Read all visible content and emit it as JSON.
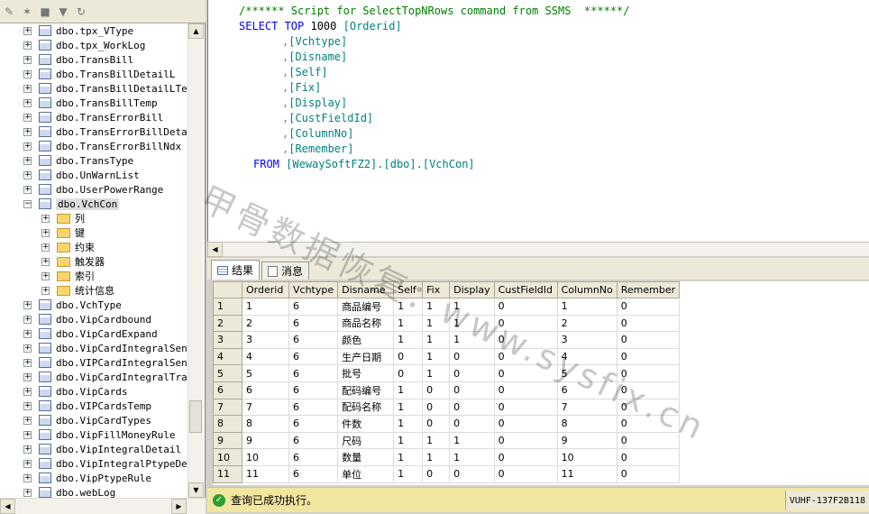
{
  "tree": {
    "items": [
      {
        "label": "dbo.tpx_VType",
        "type": "table",
        "level": 0
      },
      {
        "label": "dbo.tpx_WorkLog",
        "type": "table",
        "level": 0
      },
      {
        "label": "dbo.TransBill",
        "type": "table",
        "level": 0
      },
      {
        "label": "dbo.TransBillDetailL",
        "type": "table",
        "level": 0
      },
      {
        "label": "dbo.TransBillDetailLTemp",
        "type": "table",
        "level": 0
      },
      {
        "label": "dbo.TransBillTemp",
        "type": "table",
        "level": 0
      },
      {
        "label": "dbo.TransErrorBill",
        "type": "table",
        "level": 0
      },
      {
        "label": "dbo.TransErrorBillDetailL",
        "type": "table",
        "level": 0
      },
      {
        "label": "dbo.TransErrorBillNdx",
        "type": "table",
        "level": 0
      },
      {
        "label": "dbo.TransType",
        "type": "table",
        "level": 0
      },
      {
        "label": "dbo.UnWarnList",
        "type": "table",
        "level": 0
      },
      {
        "label": "dbo.UserPowerRange",
        "type": "table",
        "level": 0
      },
      {
        "label": "dbo.VchCon",
        "type": "table",
        "level": 0,
        "expanded": true,
        "selected": true
      },
      {
        "label": "列",
        "type": "folder",
        "level": 1
      },
      {
        "label": "键",
        "type": "folder",
        "level": 1
      },
      {
        "label": "约束",
        "type": "folder",
        "level": 1
      },
      {
        "label": "触发器",
        "type": "folder",
        "level": 1
      },
      {
        "label": "索引",
        "type": "folder",
        "level": 1
      },
      {
        "label": "统计信息",
        "type": "folder",
        "level": 1
      },
      {
        "label": "dbo.VchType",
        "type": "table",
        "level": 0
      },
      {
        "label": "dbo.VipCardbound",
        "type": "table",
        "level": 0
      },
      {
        "label": "dbo.VipCardExpand",
        "type": "table",
        "level": 0
      },
      {
        "label": "dbo.VipCardIntegralSend",
        "type": "table",
        "level": 0
      },
      {
        "label": "dbo.VIPCardIntegralSendTe",
        "type": "table",
        "level": 0
      },
      {
        "label": "dbo.VipCardIntegralTrans",
        "type": "table",
        "level": 0
      },
      {
        "label": "dbo.VipCards",
        "type": "table",
        "level": 0
      },
      {
        "label": "dbo.VIPCardsTemp",
        "type": "table",
        "level": 0
      },
      {
        "label": "dbo.VipCardTypes",
        "type": "table",
        "level": 0
      },
      {
        "label": "dbo.VipFillMoneyRule",
        "type": "table",
        "level": 0
      },
      {
        "label": "dbo.VipIntegralDetail",
        "type": "table",
        "level": 0
      },
      {
        "label": "dbo.VipIntegralPtypeDeta",
        "type": "table",
        "level": 0
      },
      {
        "label": "dbo.VipPtypeRule",
        "type": "table",
        "level": 0
      },
      {
        "label": "dbo.webLog",
        "type": "table",
        "level": 0
      }
    ]
  },
  "sql": {
    "comment": "/****** Script for SelectTopNRows command from SSMS  ******/",
    "select": "SELECT TOP",
    "top_n": "1000",
    "first_col": "[Orderid]",
    "columns": [
      "[Vchtype]",
      "[Disname]",
      "[Self]",
      "[Fix]",
      "[Display]",
      "[CustFieldId]",
      "[ColumnNo]",
      "[Remember]"
    ],
    "from_kw": "FROM",
    "from_obj": "[WewaySoftFZ2].[dbo].[VchCon]"
  },
  "tabs": {
    "results": "结果",
    "messages": "消息"
  },
  "grid": {
    "headers": [
      "",
      "Orderid",
      "Vchtype",
      "Disname",
      "Self",
      "Fix",
      "Display",
      "CustFieldId",
      "ColumnNo",
      "Remember"
    ],
    "rows": [
      [
        "1",
        "1",
        "6",
        "商品编号",
        "1",
        "1",
        "1",
        "0",
        "1",
        "0"
      ],
      [
        "2",
        "2",
        "6",
        "商品名称",
        "1",
        "1",
        "1",
        "0",
        "2",
        "0"
      ],
      [
        "3",
        "3",
        "6",
        "颜色",
        "1",
        "1",
        "1",
        "0",
        "3",
        "0"
      ],
      [
        "4",
        "4",
        "6",
        "生产日期",
        "0",
        "1",
        "0",
        "0",
        "4",
        "0"
      ],
      [
        "5",
        "5",
        "6",
        "批号",
        "0",
        "1",
        "0",
        "0",
        "5",
        "0"
      ],
      [
        "6",
        "6",
        "6",
        "配码编号",
        "1",
        "0",
        "0",
        "0",
        "6",
        "0"
      ],
      [
        "7",
        "7",
        "6",
        "配码名称",
        "1",
        "0",
        "0",
        "0",
        "7",
        "0"
      ],
      [
        "8",
        "8",
        "6",
        "件数",
        "1",
        "0",
        "0",
        "0",
        "8",
        "0"
      ],
      [
        "9",
        "9",
        "6",
        "尺码",
        "1",
        "1",
        "1",
        "0",
        "9",
        "0"
      ],
      [
        "10",
        "10",
        "6",
        "数量",
        "1",
        "1",
        "1",
        "0",
        "10",
        "0"
      ],
      [
        "11",
        "11",
        "6",
        "单位",
        "1",
        "0",
        "0",
        "0",
        "11",
        "0"
      ]
    ]
  },
  "status": {
    "message": "查询已成功执行。",
    "server": "VUHF-137F2B118"
  },
  "watermark": {
    "text": "甲骨数据恢复：www.sysfix.cn"
  }
}
